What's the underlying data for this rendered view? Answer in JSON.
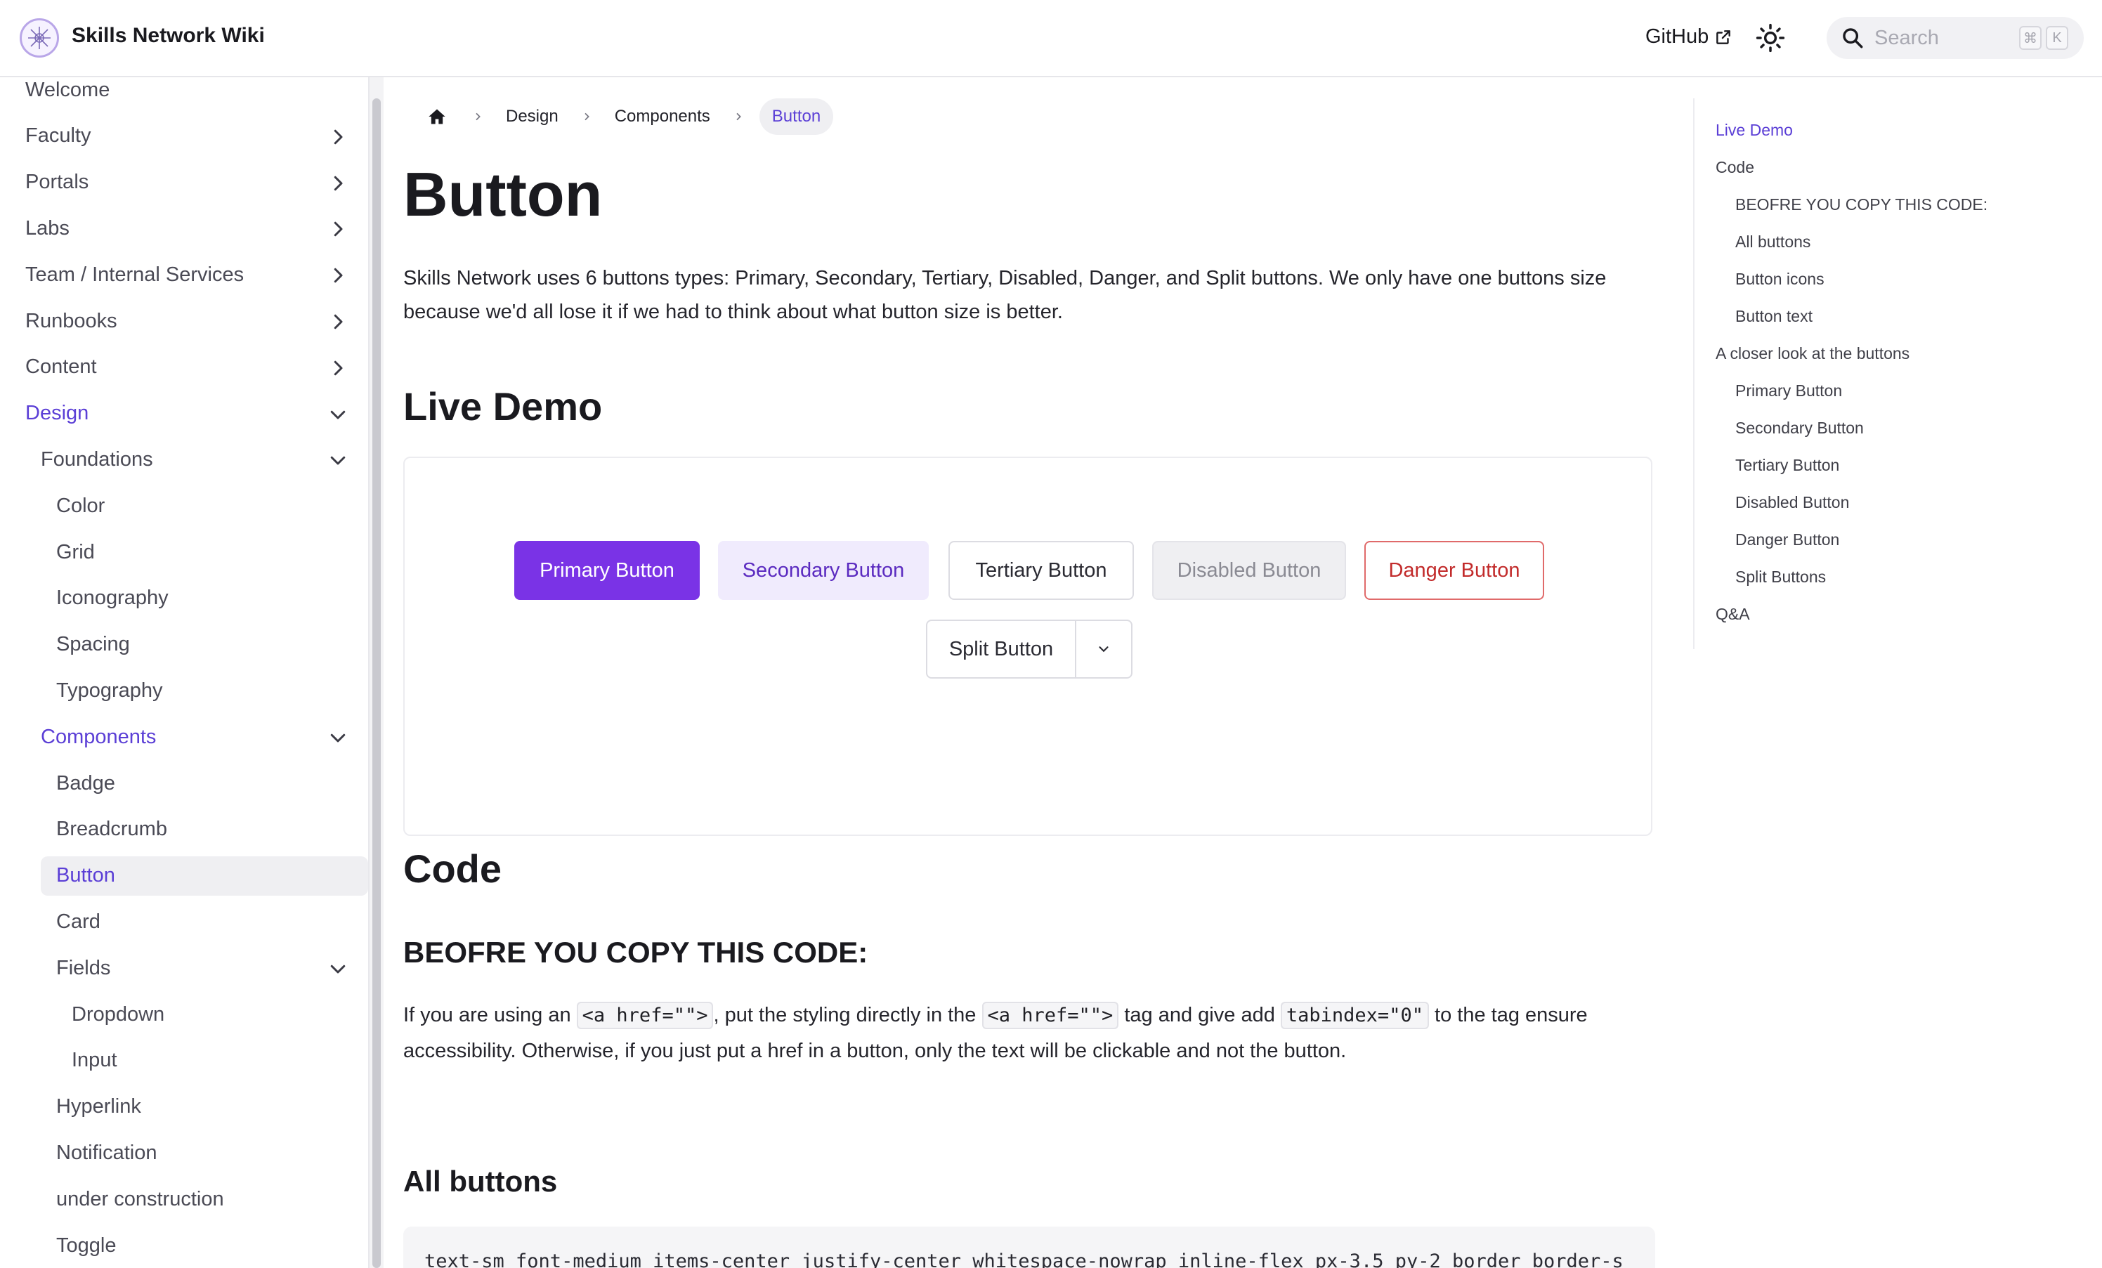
{
  "header": {
    "site_title": "Skills Network Wiki",
    "github_label": "GitHub",
    "search_placeholder": "Search",
    "search_shortcut": [
      "⌘",
      "K"
    ]
  },
  "sidebar": {
    "items": [
      {
        "label": "Welcome",
        "level": 0,
        "expandable": false
      },
      {
        "label": "Faculty",
        "level": 0,
        "expandable": true,
        "expanded": false
      },
      {
        "label": "Portals",
        "level": 0,
        "expandable": true,
        "expanded": false
      },
      {
        "label": "Labs",
        "level": 0,
        "expandable": true,
        "expanded": false
      },
      {
        "label": "Team / Internal Services",
        "level": 0,
        "expandable": true,
        "expanded": false
      },
      {
        "label": "Runbooks",
        "level": 0,
        "expandable": true,
        "expanded": false
      },
      {
        "label": "Content",
        "level": 0,
        "expandable": true,
        "expanded": false
      },
      {
        "label": "Design",
        "level": 0,
        "expandable": true,
        "expanded": true,
        "active_path": true
      },
      {
        "label": "Foundations",
        "level": 1,
        "expandable": true,
        "expanded": true
      },
      {
        "label": "Color",
        "level": 2,
        "expandable": false
      },
      {
        "label": "Grid",
        "level": 2,
        "expandable": false
      },
      {
        "label": "Iconography",
        "level": 2,
        "expandable": false
      },
      {
        "label": "Spacing",
        "level": 2,
        "expandable": false
      },
      {
        "label": "Typography",
        "level": 2,
        "expandable": false
      },
      {
        "label": "Components",
        "level": 1,
        "expandable": true,
        "expanded": true,
        "active_path": true
      },
      {
        "label": "Badge",
        "level": 2,
        "expandable": false
      },
      {
        "label": "Breadcrumb",
        "level": 2,
        "expandable": false
      },
      {
        "label": "Button",
        "level": 2,
        "expandable": false,
        "selected": true
      },
      {
        "label": "Card",
        "level": 2,
        "expandable": false
      },
      {
        "label": "Fields",
        "level": 2,
        "expandable": true,
        "expanded": true
      },
      {
        "label": "Dropdown",
        "level": 3,
        "expandable": false
      },
      {
        "label": "Input",
        "level": 3,
        "expandable": false
      },
      {
        "label": "Hyperlink",
        "level": 2,
        "expandable": false
      },
      {
        "label": "Notification",
        "level": 2,
        "expandable": false
      },
      {
        "label": "under construction",
        "level": 2,
        "expandable": false
      },
      {
        "label": "Toggle",
        "level": 2,
        "expandable": false
      }
    ]
  },
  "breadcrumb": {
    "items": [
      "Design",
      "Components"
    ],
    "current": "Button"
  },
  "main": {
    "title": "Button",
    "intro": "Skills Network uses 6 buttons types: Primary, Secondary, Tertiary, Disabled, Danger, and Split buttons. We only have one buttons size because we'd all lose it if we had to think about what button size is better.",
    "live_demo_heading": "Live Demo",
    "demo_buttons": {
      "primary": "Primary Button",
      "secondary": "Secondary Button",
      "tertiary": "Tertiary Button",
      "disabled": "Disabled Button",
      "danger": "Danger Button",
      "split": "Split Button"
    },
    "code_heading": "Code",
    "before_copy_heading": "BEOFRE YOU COPY THIS CODE:",
    "before_copy_text": {
      "p1": "If you are using an ",
      "code1": "<a href=\"\">",
      "p2": ", put the styling directly in the ",
      "code2": "<a href=\"\">",
      "p3": " tag and give add ",
      "code3": "tabindex=\"0\"",
      "p4": " to the tag ensure accessibility. Otherwise, if you just put a href in a button, only the text will be clickable and not the button."
    },
    "all_buttons_heading": "All buttons",
    "code_snippet": "text-sm font-medium items-center justify-center whitespace-nowrap inline-flex px-3.5 py-2 border border-s"
  },
  "toc": {
    "items": [
      {
        "label": "Live Demo",
        "level": 0,
        "active": true
      },
      {
        "label": "Code",
        "level": 0
      },
      {
        "label": "BEOFRE YOU COPY THIS CODE:",
        "level": 1
      },
      {
        "label": "All buttons",
        "level": 1
      },
      {
        "label": "Button icons",
        "level": 1
      },
      {
        "label": "Button text",
        "level": 1
      },
      {
        "label": "A closer look at the buttons",
        "level": 0
      },
      {
        "label": "Primary Button",
        "level": 1
      },
      {
        "label": "Secondary Button",
        "level": 1
      },
      {
        "label": "Tertiary Button",
        "level": 1
      },
      {
        "label": "Disabled Button",
        "level": 1
      },
      {
        "label": "Danger Button",
        "level": 1
      },
      {
        "label": "Split Buttons",
        "level": 1
      },
      {
        "label": "Q&A",
        "level": 0
      }
    ]
  },
  "colors": {
    "accent": "#5b3fd6",
    "primary_button": "#7a33e6",
    "secondary_button_bg": "#f0ebfd",
    "danger": "#c22b2b",
    "selected_bg": "#efeff2"
  }
}
